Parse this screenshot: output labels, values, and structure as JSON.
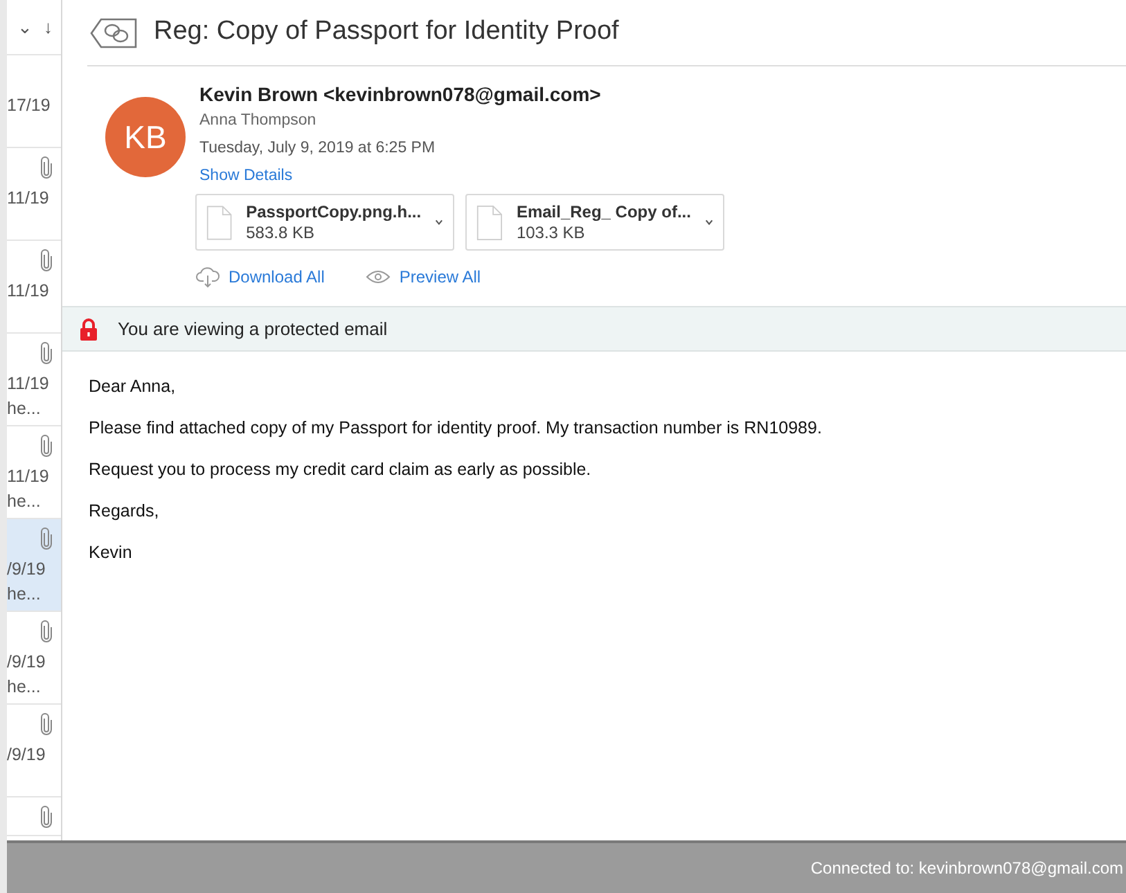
{
  "message_list": {
    "sort_controls": [
      "⌄",
      "↓"
    ],
    "items": [
      {
        "date": "17/19",
        "has_attachment": false,
        "selected": false
      },
      {
        "date": "11/19",
        "has_attachment": true,
        "selected": false
      },
      {
        "date": "11/19",
        "has_attachment": true,
        "selected": false
      },
      {
        "date": "11/19",
        "preview": "he...",
        "has_attachment": true,
        "selected": false
      },
      {
        "date": "11/19",
        "preview": "he...",
        "has_attachment": true,
        "selected": false
      },
      {
        "date": "/9/19",
        "preview": "he...",
        "has_attachment": true,
        "selected": true
      },
      {
        "date": "/9/19",
        "preview": "he...",
        "has_attachment": true,
        "selected": false
      },
      {
        "date": "/9/19",
        "has_attachment": true,
        "selected": false
      },
      {
        "has_attachment": true,
        "selected": false
      }
    ]
  },
  "email": {
    "subject": "Reg: Copy of Passport for Identity Proof",
    "avatar_initials": "KB",
    "sender": "Kevin Brown <kevinbrown078@gmail.com>",
    "recipient": "Anna Thompson",
    "date": "Tuesday, July 9, 2019 at 6:25 PM",
    "show_details": "Show Details",
    "attachments": [
      {
        "name": "PassportCopy.png.h...",
        "size": "583.8 KB"
      },
      {
        "name": "Email_Reg_ Copy of...",
        "size": "103.3 KB"
      }
    ],
    "actions": [
      {
        "kind": "download",
        "label": "Download All"
      },
      {
        "kind": "preview",
        "label": "Preview All"
      }
    ],
    "protection_notice": "You are viewing a protected email",
    "body": [
      "Dear Anna,",
      "Please find attached copy of my Passport for identity proof. My transaction number is RN10989.",
      "Request you to process my credit card claim as early as possible.",
      "Regards,",
      "Kevin"
    ]
  },
  "status_bar": "Connected to: kevinbrown078@gmail.com"
}
